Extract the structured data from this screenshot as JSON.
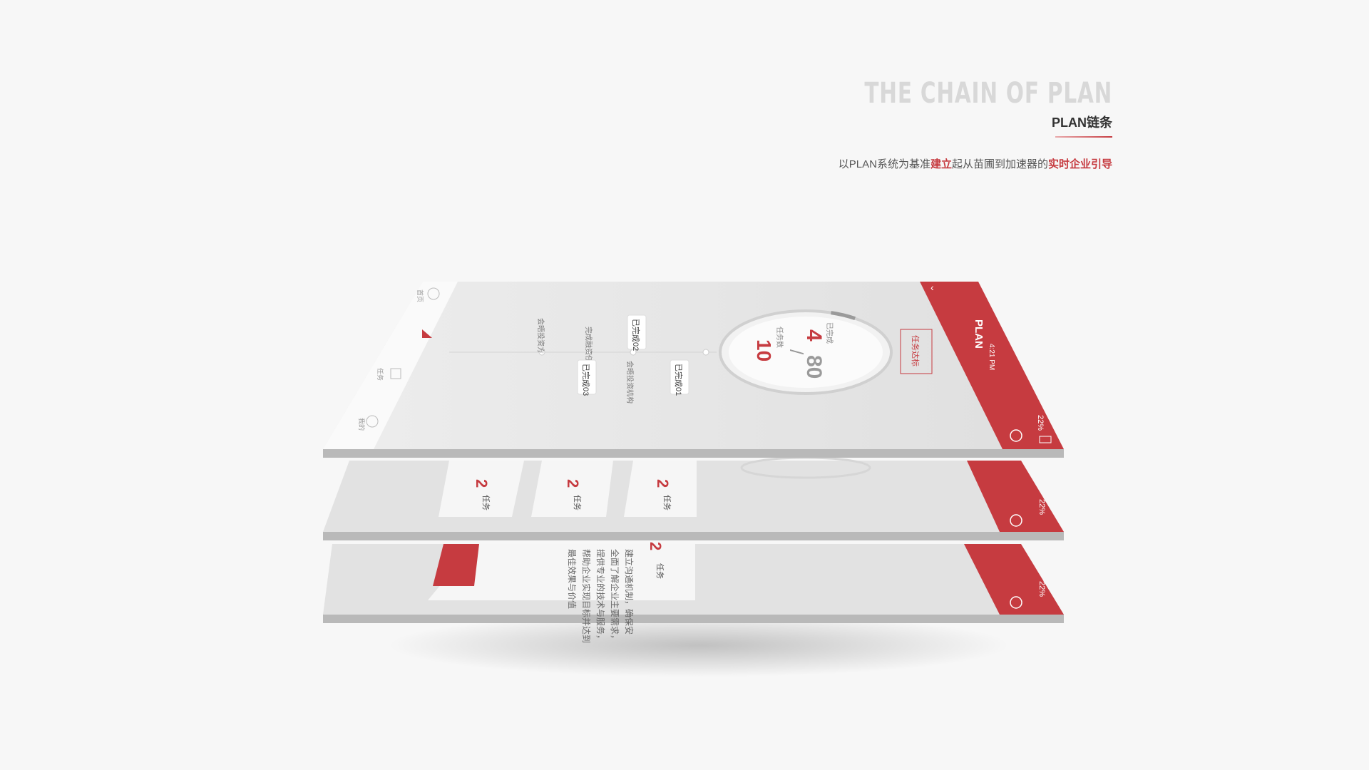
{
  "header": {
    "title_en": "THE CHAIN OF PLAN",
    "title_cn": "PLAN链条",
    "slogan_parts": [
      "以PLAN系统为基准",
      "建立",
      "起从苗圃到加速器的",
      "实时企业引导"
    ]
  },
  "colors": {
    "accent": "#c63b40",
    "panel": "#e4e4e4",
    "edge": "#b9b9b9",
    "bg": "#f7f7f7"
  },
  "app": {
    "brand": "PLAN",
    "status_time": "4:21 PM",
    "battery": "22%",
    "back_icon": "chevron-left-icon",
    "help_icon": "help-icon",
    "stamp": "任务达标",
    "ring": {
      "label_top": "已完成",
      "done": "4",
      "total": "80",
      "label_sub": "任务数",
      "count": "10",
      "progress": 0.05
    },
    "timeline": [
      {
        "tag": "已完成01",
        "note": "会晤投资机构"
      },
      {
        "tag": "已完成02",
        "note": "完成融资任务"
      },
      {
        "tag": "已完成03",
        "note": "会晤投资方"
      }
    ],
    "tab_labels": [
      "首页",
      "任务",
      "我的"
    ],
    "cards": [
      {
        "num": "2",
        "unit": "任务"
      },
      {
        "num": "2",
        "unit": "任务"
      },
      {
        "num": "2",
        "unit": "任务"
      }
    ],
    "article": {
      "num": "2",
      "unit": "任务",
      "lines": [
        "建立沟通机制，确保安",
        "全面了解企业主要需求，",
        "提供专业的技术与服务，",
        "帮助企业实现目标并达到",
        "最佳效果与价值"
      ]
    }
  }
}
